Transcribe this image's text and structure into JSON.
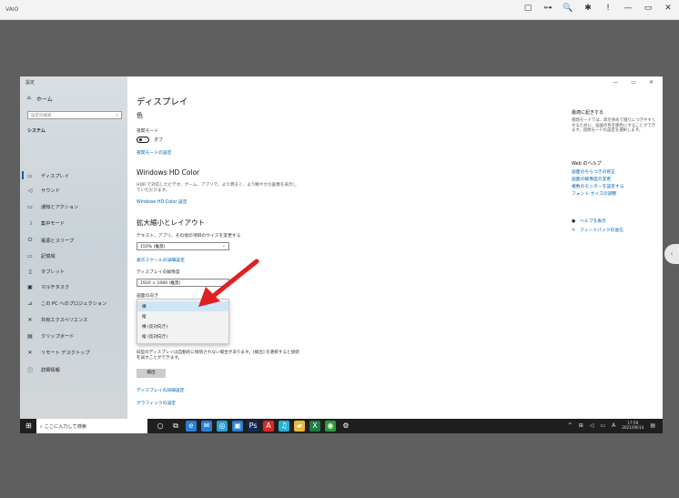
{
  "outer_window": {
    "title": "VAIO",
    "controls": [
      "▢",
      "⊶",
      "🔍",
      "✱",
      "!",
      "—",
      "▭",
      "✕"
    ]
  },
  "settings_window": {
    "title": "設定",
    "controls": [
      "—",
      "▭",
      "✕"
    ]
  },
  "sidebar": {
    "home": "ホーム",
    "search_placeholder": "設定の検索",
    "section": "システム",
    "items": [
      {
        "label": "ディスプレイ",
        "icon": "monitor-icon",
        "glyph": "▭",
        "active": true
      },
      {
        "label": "サウンド",
        "icon": "speaker-icon",
        "glyph": "◁"
      },
      {
        "label": "通知とアクション",
        "icon": "notification-icon",
        "glyph": "▭"
      },
      {
        "label": "集中モード",
        "icon": "moon-icon",
        "glyph": "☽"
      },
      {
        "label": "電源とスリープ",
        "icon": "power-icon",
        "glyph": "⏻"
      },
      {
        "label": "記憶域",
        "icon": "storage-icon",
        "glyph": "▭"
      },
      {
        "label": "タブレット",
        "icon": "tablet-icon",
        "glyph": "▯"
      },
      {
        "label": "マルチタスク",
        "icon": "multitask-icon",
        "glyph": "▣"
      },
      {
        "label": "この PC へのプロジェクション",
        "icon": "projection-icon",
        "glyph": "⊿"
      },
      {
        "label": "共有エクスペリエンス",
        "icon": "shared-icon",
        "glyph": "✕"
      },
      {
        "label": "クリップボード",
        "icon": "clipboard-icon",
        "glyph": "▤"
      },
      {
        "label": "リモート デスクトップ",
        "icon": "remote-icon",
        "glyph": "✕"
      },
      {
        "label": "詳細情報",
        "icon": "info-icon",
        "glyph": "ⓘ"
      }
    ]
  },
  "main": {
    "title": "ディスプレイ",
    "color_heading": "色",
    "night_light_label": "夜間モード",
    "night_light_state": "オフ",
    "night_light_link": "夜間モードの設定",
    "hdr_heading": "Windows HD Color",
    "hdr_desc": "HDR で対応したビデオ、ゲーム、アプリで、より明るく、より鮮やかな画像を表示していただけます。",
    "hdr_link": "Windows HD Color 設定",
    "scale_heading": "拡大縮小とレイアウト",
    "scale_label": "テキスト、アプリ、その他の項目のサイズを変更する",
    "scale_value": "150% (推奨)",
    "scale_link": "表示スケールの詳細設定",
    "resolution_label": "ディスプレイの解像度",
    "resolution_value": "1920 × 1080 (推奨)",
    "orientation_label": "画面の向き",
    "orientation_options": [
      "横",
      "縦",
      "横 (反対向き)",
      "縦 (反対向き)"
    ],
    "detect_note": "旧型のディスプレイは自動的に接続されない場合があります。[検出] を選択すると接続を試すことができます。",
    "detect_button": "検出",
    "advanced_link": "ディスプレイの詳細設定",
    "graphics_link": "グラフィックの設定"
  },
  "right_panel": {
    "sleep_heading": "最適に起きする",
    "sleep_text": "夜間モードでは、目を休めて眠りにつきやすくするために、画面の色を暖色にすることができます。夜間モードの設定を選択します。",
    "web_help": "Web のヘルプ",
    "links": [
      "画面のちらつきの修正",
      "画面の解像度の変更",
      "複数のモニターを設定する",
      "フォント サイズの調整"
    ],
    "help": "ヘルプを表示",
    "feedback": "フィードバックの送信"
  },
  "taskbar": {
    "search_placeholder": "ここに入力して検索",
    "apps": [
      {
        "name": "cortana-icon",
        "glyph": "○",
        "color": "#1f1f1f"
      },
      {
        "name": "task-view-icon",
        "glyph": "⧉",
        "color": "#1f1f1f"
      },
      {
        "name": "edge-icon",
        "glyph": "e",
        "color": "#2a7fd4"
      },
      {
        "name": "mail-icon",
        "glyph": "✉",
        "color": "#2a7fd4"
      },
      {
        "name": "photos-icon",
        "glyph": "◎",
        "color": "#2aa0d4"
      },
      {
        "name": "store-icon",
        "glyph": "▣",
        "color": "#2a7fd4"
      },
      {
        "name": "photoshop-icon",
        "glyph": "Ps",
        "color": "#14285a"
      },
      {
        "name": "acrobat-icon",
        "glyph": "A",
        "color": "#d42a2a"
      },
      {
        "name": "music-icon",
        "glyph": "♫",
        "color": "#2ab0d4"
      },
      {
        "name": "explorer-icon",
        "glyph": "▰",
        "color": "#e8b83a"
      },
      {
        "name": "excel-icon",
        "glyph": "X",
        "color": "#1e7a44"
      },
      {
        "name": "chrome-icon",
        "glyph": "◉",
        "color": "#2a9a3a"
      },
      {
        "name": "settings-icon",
        "glyph": "⚙",
        "color": "#1f1f1f"
      }
    ],
    "tray": [
      "^",
      "⊞",
      "◁",
      "▭",
      "A"
    ],
    "time": "17:59",
    "date": "2021/09/14"
  }
}
